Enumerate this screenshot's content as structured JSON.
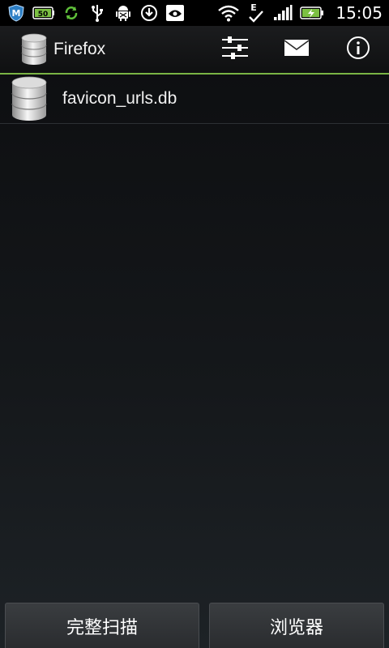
{
  "status_bar": {
    "time": "15:05",
    "icons_left": [
      "shield-m-icon",
      "battery-saver-50-icon",
      "sync-icon",
      "usb-icon",
      "android-debug-icon",
      "download-icon",
      "eye-app-icon"
    ],
    "icons_right": [
      "wifi-icon",
      "edge-data-icon",
      "signal-icon",
      "battery-charging-icon"
    ],
    "badge_50": "50",
    "edge_letter": "E"
  },
  "action_bar": {
    "title": "Firefox",
    "accent_color": "#7ab344"
  },
  "list": {
    "items": [
      {
        "label": "favicon_urls.db",
        "icon": "database-icon"
      }
    ]
  },
  "bottom_bar": {
    "full_scan_label": "完整扫描",
    "browser_label": "浏览器"
  }
}
